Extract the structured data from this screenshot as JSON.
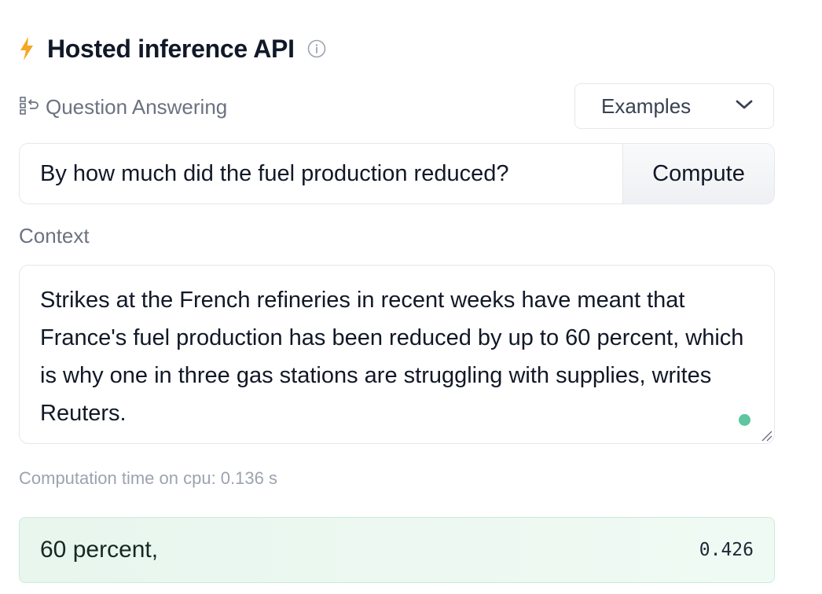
{
  "header": {
    "title": "Hosted inference API",
    "bolt_icon": "lightning-bolt-icon",
    "info_icon": "info-icon",
    "accent_color": "#f6a623"
  },
  "task": {
    "icon": "question-answering-icon",
    "label": "Question Answering"
  },
  "examples_dropdown": {
    "label": "Examples",
    "icon": "chevron-down-icon"
  },
  "question": {
    "value": "By how much did the fuel production reduced?",
    "compute_label": "Compute"
  },
  "context": {
    "label": "Context",
    "value": "Strikes at the French refineries in recent weeks have meant that France's fuel production has been reduced by up to 60 percent, which is why one in three gas stations are struggling with supplies, writes Reuters.",
    "status_dot_color": "#5ec6a0"
  },
  "computation": {
    "time_text": "Computation time on cpu: 0.136 s"
  },
  "answer": {
    "text": "60 percent,",
    "score": "0.426"
  }
}
